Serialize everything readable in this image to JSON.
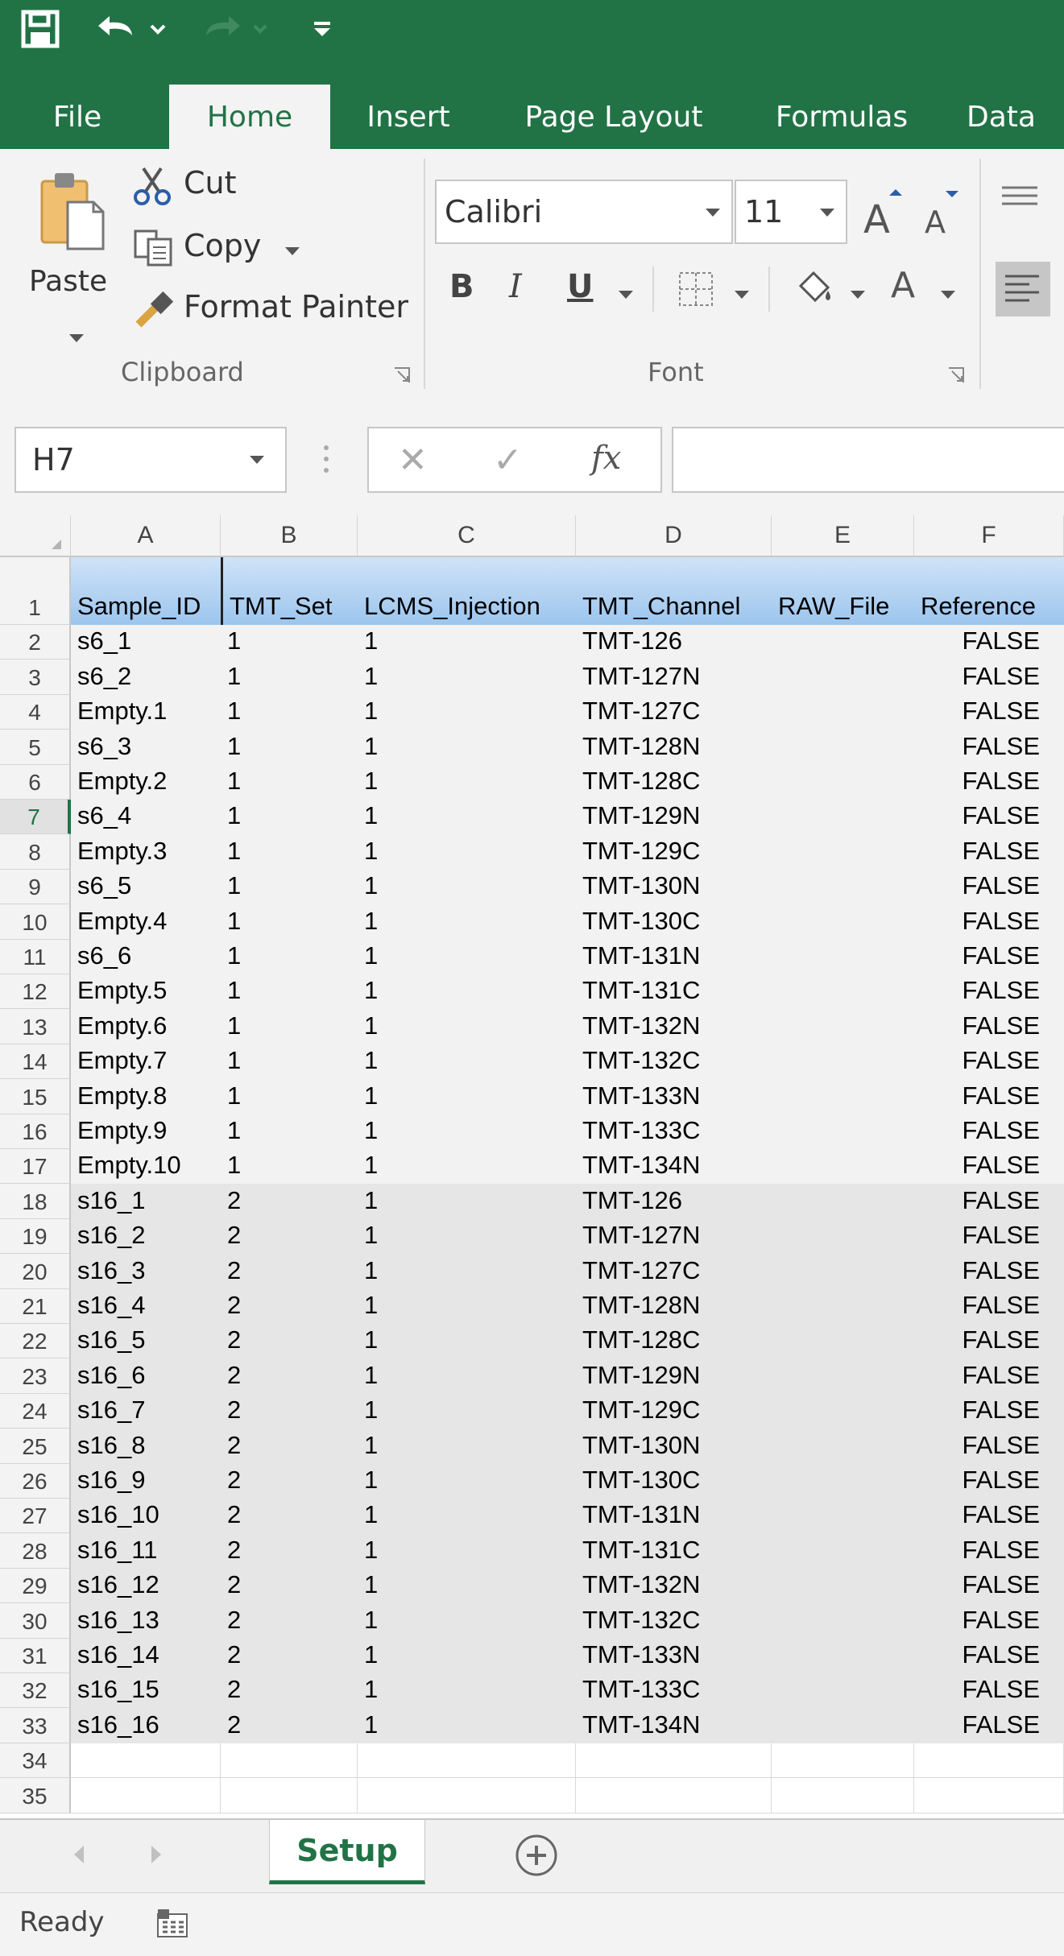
{
  "qat": {
    "save_icon": "save-icon",
    "undo_icon": "undo-icon",
    "redo_icon": "redo-icon",
    "customize_icon": "customize-qat-icon"
  },
  "tabs": [
    {
      "label": "File"
    },
    {
      "label": "Home",
      "active": true
    },
    {
      "label": "Insert"
    },
    {
      "label": "Page Layout"
    },
    {
      "label": "Formulas"
    },
    {
      "label": "Data"
    }
  ],
  "ribbon": {
    "clipboard": {
      "paste": "Paste",
      "cut": "Cut",
      "copy": "Copy",
      "format_painter": "Format Painter",
      "group_label": "Clipboard"
    },
    "font": {
      "font_name": "Calibri",
      "font_size": "11",
      "bold": "B",
      "italic": "I",
      "underline": "U",
      "font_color": "A",
      "group_label": "Font"
    }
  },
  "formula_bar": {
    "name_box": "H7",
    "cancel": "✕",
    "enter": "✓",
    "fx": "fx",
    "content": ""
  },
  "columns": [
    "A",
    "B",
    "C",
    "D",
    "E",
    "F"
  ],
  "header_row": {
    "number": "1",
    "cells": [
      "Sample_ID",
      "TMT_Set",
      "LCMS_Injection",
      "TMT_Channel",
      "RAW_File",
      "Reference"
    ]
  },
  "rows": [
    {
      "n": "2",
      "a": "s6_1",
      "b": "1",
      "c": "1",
      "d": "TMT-126",
      "e": "",
      "f": "FALSE"
    },
    {
      "n": "3",
      "a": "s6_2",
      "b": "1",
      "c": "1",
      "d": "TMT-127N",
      "e": "",
      "f": "FALSE"
    },
    {
      "n": "4",
      "a": "Empty.1",
      "b": "1",
      "c": "1",
      "d": "TMT-127C",
      "e": "",
      "f": "FALSE"
    },
    {
      "n": "5",
      "a": "s6_3",
      "b": "1",
      "c": "1",
      "d": "TMT-128N",
      "e": "",
      "f": "FALSE"
    },
    {
      "n": "6",
      "a": "Empty.2",
      "b": "1",
      "c": "1",
      "d": "TMT-128C",
      "e": "",
      "f": "FALSE"
    },
    {
      "n": "7",
      "a": "s6_4",
      "b": "1",
      "c": "1",
      "d": "TMT-129N",
      "e": "",
      "f": "FALSE"
    },
    {
      "n": "8",
      "a": "Empty.3",
      "b": "1",
      "c": "1",
      "d": "TMT-129C",
      "e": "",
      "f": "FALSE"
    },
    {
      "n": "9",
      "a": "s6_5",
      "b": "1",
      "c": "1",
      "d": "TMT-130N",
      "e": "",
      "f": "FALSE"
    },
    {
      "n": "10",
      "a": "Empty.4",
      "b": "1",
      "c": "1",
      "d": "TMT-130C",
      "e": "",
      "f": "FALSE"
    },
    {
      "n": "11",
      "a": "s6_6",
      "b": "1",
      "c": "1",
      "d": "TMT-131N",
      "e": "",
      "f": "FALSE"
    },
    {
      "n": "12",
      "a": "Empty.5",
      "b": "1",
      "c": "1",
      "d": "TMT-131C",
      "e": "",
      "f": "FALSE"
    },
    {
      "n": "13",
      "a": "Empty.6",
      "b": "1",
      "c": "1",
      "d": "TMT-132N",
      "e": "",
      "f": "FALSE"
    },
    {
      "n": "14",
      "a": "Empty.7",
      "b": "1",
      "c": "1",
      "d": "TMT-132C",
      "e": "",
      "f": "FALSE"
    },
    {
      "n": "15",
      "a": "Empty.8",
      "b": "1",
      "c": "1",
      "d": "TMT-133N",
      "e": "",
      "f": "FALSE"
    },
    {
      "n": "16",
      "a": "Empty.9",
      "b": "1",
      "c": "1",
      "d": "TMT-133C",
      "e": "",
      "f": "FALSE"
    },
    {
      "n": "17",
      "a": "Empty.10",
      "b": "1",
      "c": "1",
      "d": "TMT-134N",
      "e": "",
      "f": "FALSE"
    },
    {
      "n": "18",
      "a": "s16_1",
      "b": "2",
      "c": "1",
      "d": "TMT-126",
      "e": "",
      "f": "FALSE"
    },
    {
      "n": "19",
      "a": "s16_2",
      "b": "2",
      "c": "1",
      "d": "TMT-127N",
      "e": "",
      "f": "FALSE"
    },
    {
      "n": "20",
      "a": "s16_3",
      "b": "2",
      "c": "1",
      "d": "TMT-127C",
      "e": "",
      "f": "FALSE"
    },
    {
      "n": "21",
      "a": "s16_4",
      "b": "2",
      "c": "1",
      "d": "TMT-128N",
      "e": "",
      "f": "FALSE"
    },
    {
      "n": "22",
      "a": "s16_5",
      "b": "2",
      "c": "1",
      "d": "TMT-128C",
      "e": "",
      "f": "FALSE"
    },
    {
      "n": "23",
      "a": "s16_6",
      "b": "2",
      "c": "1",
      "d": "TMT-129N",
      "e": "",
      "f": "FALSE"
    },
    {
      "n": "24",
      "a": "s16_7",
      "b": "2",
      "c": "1",
      "d": "TMT-129C",
      "e": "",
      "f": "FALSE"
    },
    {
      "n": "25",
      "a": "s16_8",
      "b": "2",
      "c": "1",
      "d": "TMT-130N",
      "e": "",
      "f": "FALSE"
    },
    {
      "n": "26",
      "a": "s16_9",
      "b": "2",
      "c": "1",
      "d": "TMT-130C",
      "e": "",
      "f": "FALSE"
    },
    {
      "n": "27",
      "a": "s16_10",
      "b": "2",
      "c": "1",
      "d": "TMT-131N",
      "e": "",
      "f": "FALSE"
    },
    {
      "n": "28",
      "a": "s16_11",
      "b": "2",
      "c": "1",
      "d": "TMT-131C",
      "e": "",
      "f": "FALSE"
    },
    {
      "n": "29",
      "a": "s16_12",
      "b": "2",
      "c": "1",
      "d": "TMT-132N",
      "e": "",
      "f": "FALSE"
    },
    {
      "n": "30",
      "a": "s16_13",
      "b": "2",
      "c": "1",
      "d": "TMT-132C",
      "e": "",
      "f": "FALSE"
    },
    {
      "n": "31",
      "a": "s16_14",
      "b": "2",
      "c": "1",
      "d": "TMT-133N",
      "e": "",
      "f": "FALSE"
    },
    {
      "n": "32",
      "a": "s16_15",
      "b": "2",
      "c": "1",
      "d": "TMT-133C",
      "e": "",
      "f": "FALSE"
    },
    {
      "n": "33",
      "a": "s16_16",
      "b": "2",
      "c": "1",
      "d": "TMT-134N",
      "e": "",
      "f": "FALSE"
    }
  ],
  "empty_rows": [
    "34",
    "35"
  ],
  "selected_row": "7",
  "sheet_tabs": [
    {
      "label": "Setup",
      "active": true
    }
  ],
  "status": {
    "text": "Ready"
  },
  "colors": {
    "brand": "#217346",
    "header_fill": "#9cc5ee",
    "group1_fill": "#f2f2f2",
    "group2_fill": "#e6e6e6"
  }
}
